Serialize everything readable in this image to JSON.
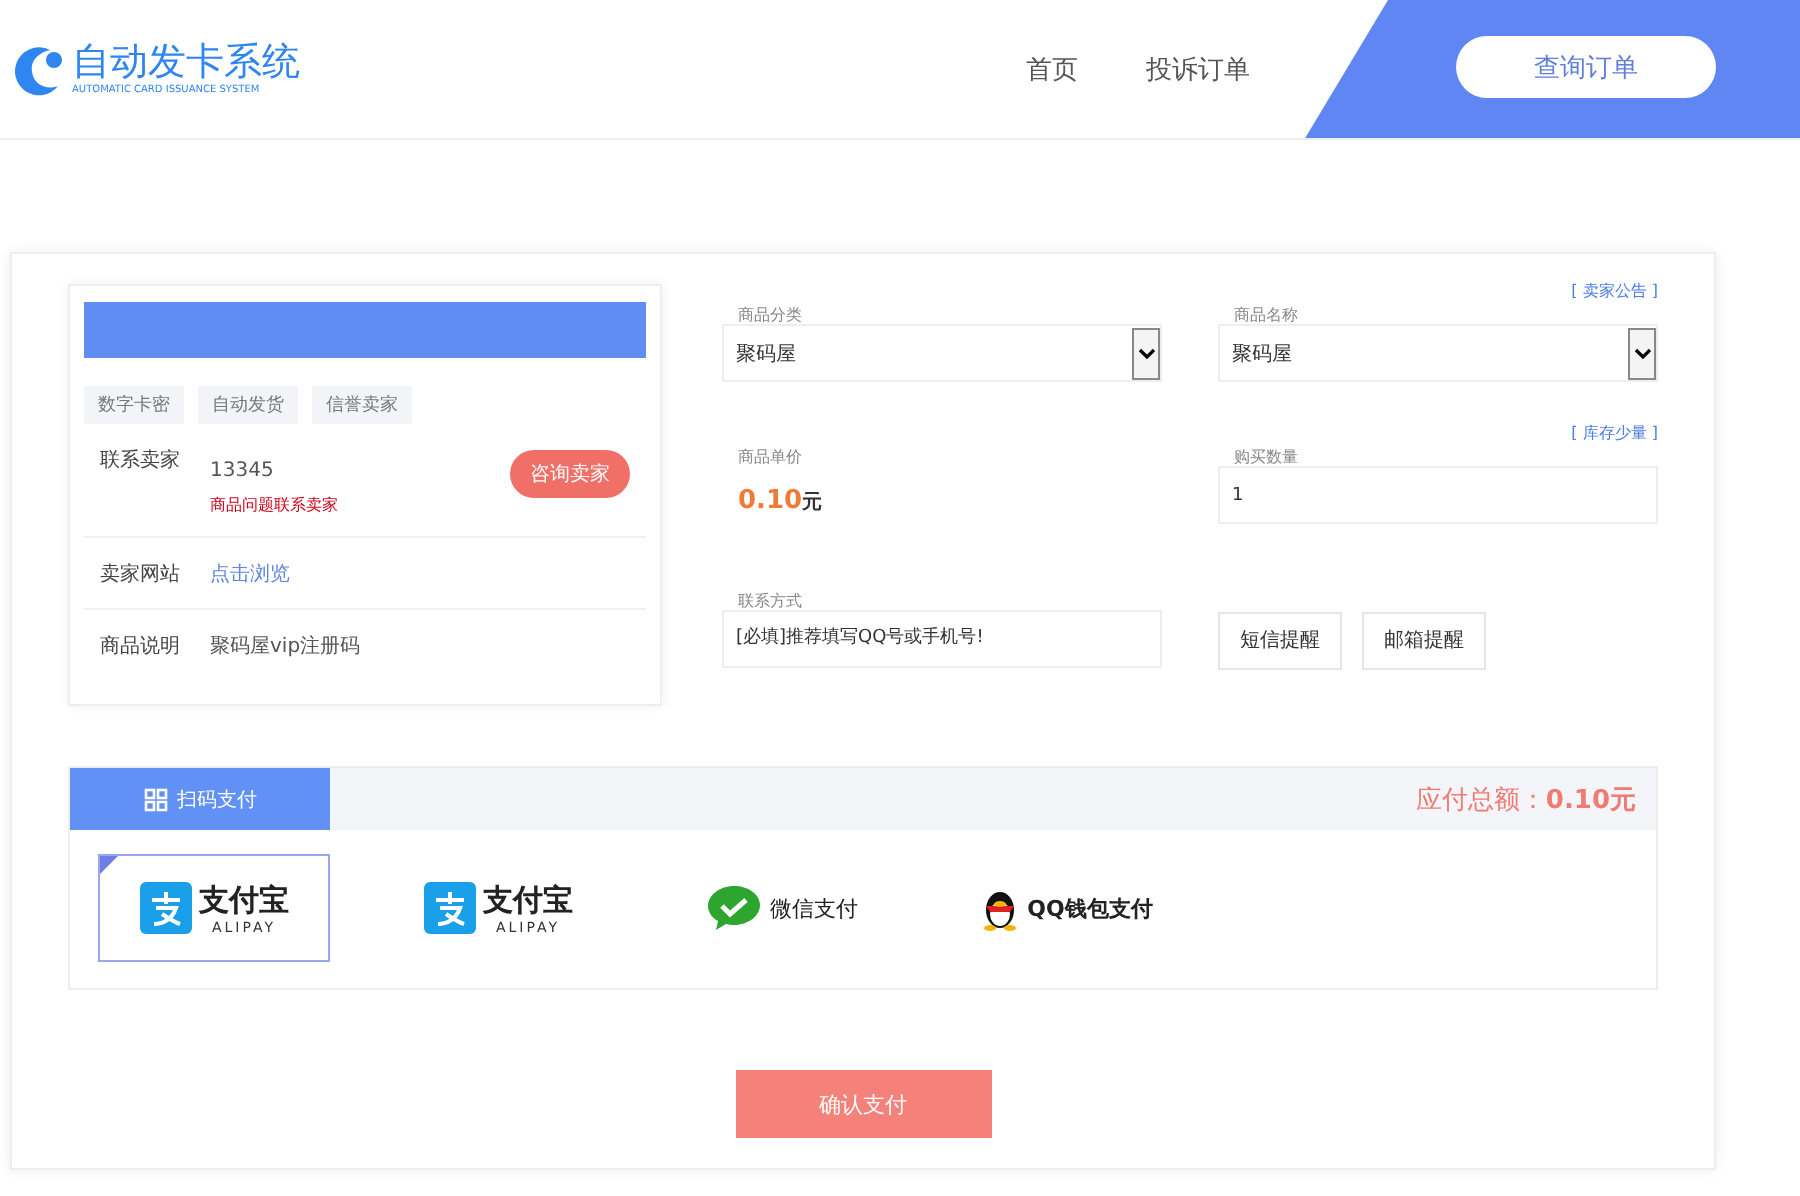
{
  "header": {
    "logo": {
      "title": "自动发卡系统",
      "subtitle": "AUTOMATIC CARD ISSUANCE SYSTEM"
    },
    "nav": [
      {
        "label": "首页"
      },
      {
        "label": "投诉订单"
      }
    ],
    "query_button": "查询订单"
  },
  "seller_card": {
    "tags": [
      "数字卡密",
      "自动发货",
      "信誉卖家"
    ],
    "rows": [
      {
        "kind": "contact",
        "label": "联系卖家",
        "value": "13345",
        "note": "商品问题联系卖家",
        "button": "咨询卖家"
      },
      {
        "kind": "link",
        "label": "卖家网站",
        "value": "点击浏览"
      },
      {
        "kind": "text",
        "label": "商品说明",
        "value": "聚码屋vip注册码"
      }
    ]
  },
  "form": {
    "category": {
      "label": "商品分类",
      "value": "聚码屋"
    },
    "product": {
      "label": "商品名称",
      "value": "聚码屋",
      "link": "[ 卖家公告 ]"
    },
    "price": {
      "label": "商品单价",
      "amount": "0.10",
      "unit": "元"
    },
    "quantity": {
      "label": "购买数量",
      "value": "1",
      "link": "[ 库存少量 ]"
    },
    "contact": {
      "label": "联系方式",
      "placeholder": "[必填]推荐填写QQ号或手机号!"
    },
    "buttons": [
      "短信提醒",
      "邮箱提醒"
    ]
  },
  "payment": {
    "tab": "扫码支付",
    "total_label": "应付总额：",
    "total": "0.10元",
    "methods": [
      {
        "kind": "alipay",
        "name": "支付宝",
        "sub": "ALIPAY",
        "selected": true
      },
      {
        "kind": "alipay",
        "name": "支付宝",
        "sub": "ALIPAY",
        "selected": false
      },
      {
        "kind": "wechat",
        "name": "微信支付",
        "selected": false
      },
      {
        "kind": "qq",
        "name": "QQ钱包支付",
        "selected": false
      }
    ],
    "confirm": "确认支付"
  }
}
